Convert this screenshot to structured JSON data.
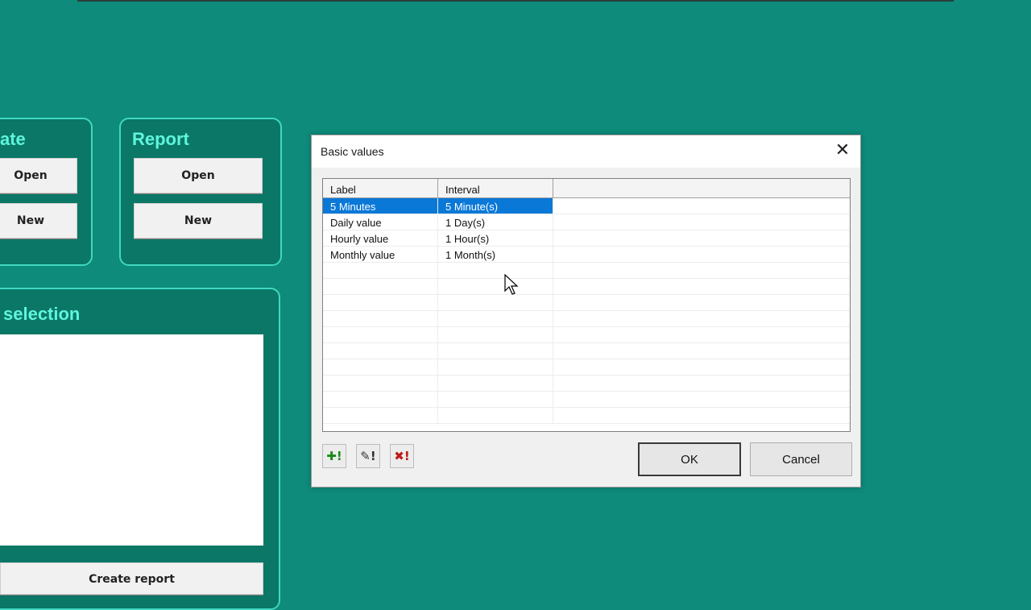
{
  "background": {
    "panel1_title": "ate",
    "panel1_open": "Open",
    "panel1_new": "New",
    "report_title": "Report",
    "report_open": "Open",
    "report_new": "New",
    "selection_title": "selection",
    "create_report": "Create report"
  },
  "dialog": {
    "title": "Basic values",
    "close_glyph": "✕",
    "columns": [
      "Label",
      "Interval"
    ],
    "rows": [
      {
        "label": "5 Minutes",
        "interval": "5 Minute(s)"
      },
      {
        "label": "Daily value",
        "interval": "1 Day(s)"
      },
      {
        "label": "Hourly value",
        "interval": "1 Hour(s)"
      },
      {
        "label": "Monthly value",
        "interval": "1 Month(s)"
      }
    ],
    "toolbar": {
      "add_glyph": "✚!",
      "edit_glyph": "✎!",
      "delete_glyph": "✖!"
    },
    "ok_label": "OK",
    "cancel_label": "Cancel"
  },
  "colors": {
    "background": "#0e8b7a",
    "panel": "#0b7767",
    "panel_border": "#3fd8c0",
    "panel_title": "#5ff5dd",
    "selection": "#0a78d7",
    "add_icon": "#1a8a1a",
    "delete_icon": "#c01818"
  }
}
